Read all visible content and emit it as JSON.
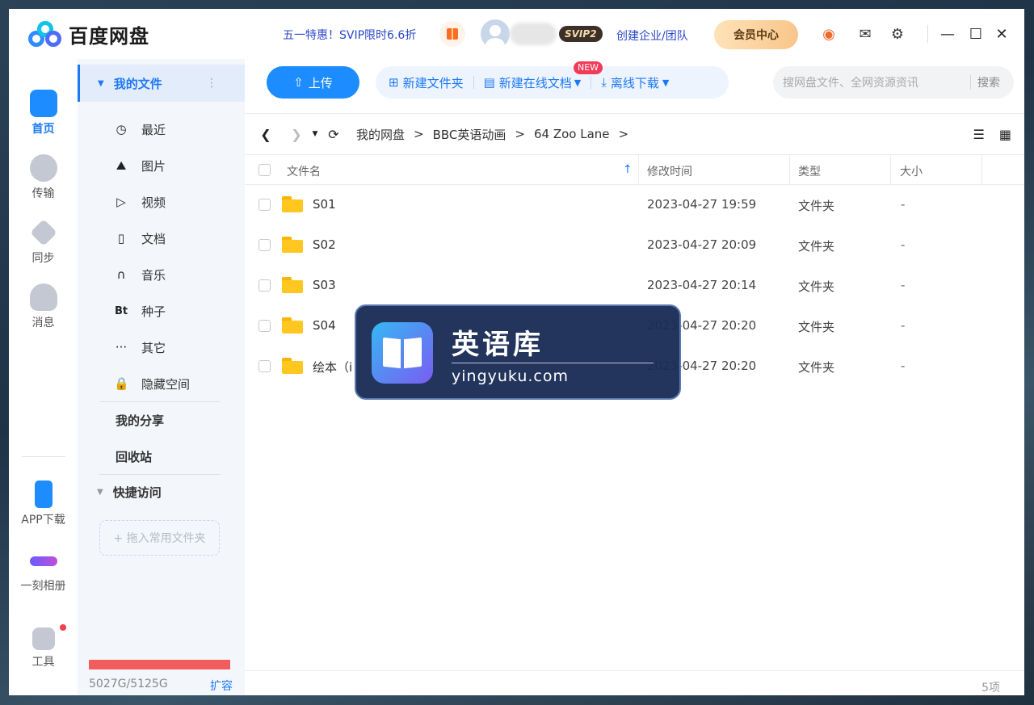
{
  "app": {
    "name": "百度网盘"
  },
  "topbar": {
    "promo": "五一特惠！SVIP限时6.6折",
    "svip_badge": "SVIP2",
    "enterprise": "创建企业/团队",
    "vip_center": "会员中心"
  },
  "rail": {
    "items": [
      {
        "label": "首页",
        "icon": "cloud-icon"
      },
      {
        "label": "传输",
        "icon": "transfer-icon"
      },
      {
        "label": "同步",
        "icon": "sync-icon"
      },
      {
        "label": "消息",
        "icon": "message-icon"
      }
    ],
    "bottom": [
      {
        "label": "APP下载",
        "icon": "phone-icon"
      },
      {
        "label": "一刻相册",
        "icon": "album-icon"
      },
      {
        "label": "工具",
        "icon": "tools-icon"
      }
    ]
  },
  "sidebar": {
    "my_files": "我的文件",
    "categories": [
      {
        "label": "最近",
        "icon": "clock-icon",
        "glyph": "◷"
      },
      {
        "label": "图片",
        "icon": "image-icon",
        "glyph": "⛰"
      },
      {
        "label": "视频",
        "icon": "video-icon",
        "glyph": "▷"
      },
      {
        "label": "文档",
        "icon": "document-icon",
        "glyph": "▯"
      },
      {
        "label": "音乐",
        "icon": "headphones-icon",
        "glyph": "∩"
      },
      {
        "label": "种子",
        "icon": "bt-icon",
        "glyph": "Bt"
      },
      {
        "label": "其它",
        "icon": "more-icon",
        "glyph": "···"
      },
      {
        "label": "隐藏空间",
        "icon": "lock-icon",
        "glyph": "🔒"
      }
    ],
    "my_share": "我的分享",
    "recycle": "回收站",
    "quick_access": "快捷访问",
    "drop_hint": "+ 拖入常用文件夹",
    "storage": "5027G/5125G",
    "storage_used_fraction": 0.981,
    "expand": "扩容"
  },
  "toolbar": {
    "upload": "上传",
    "new_folder": "新建文件夹",
    "new_online_doc": "新建在线文档",
    "new_badge": "NEW",
    "offline_download": "离线下载",
    "search_placeholder": "搜网盘文件、全网资源资讯",
    "search_button": "搜索"
  },
  "breadcrumb": [
    "我的网盘",
    "BBC英语动画",
    "64 Zoo Lane"
  ],
  "table": {
    "headers": {
      "name": "文件名",
      "modified": "修改时间",
      "type": "类型",
      "size": "大小"
    },
    "rows": [
      {
        "name": "S01",
        "modified": "2023-04-27 19:59",
        "type": "文件夹",
        "size": "-"
      },
      {
        "name": "S02",
        "modified": "2023-04-27 20:09",
        "type": "文件夹",
        "size": "-"
      },
      {
        "name": "S03",
        "modified": "2023-04-27 20:14",
        "type": "文件夹",
        "size": "-"
      },
      {
        "name": "S04",
        "modified": "2023-04-27 20:20",
        "type": "文件夹",
        "size": "-"
      },
      {
        "name": "绘本（i",
        "modified": "2023-04-27 20:20",
        "type": "文件夹",
        "size": "-"
      }
    ],
    "count": "5项"
  },
  "watermark": {
    "title": "英语库",
    "subtitle": "yingyuku.com"
  },
  "colors": {
    "accent": "#1c79f5",
    "folder": "#ffc71f",
    "storage_bar": "#f35c5c"
  }
}
